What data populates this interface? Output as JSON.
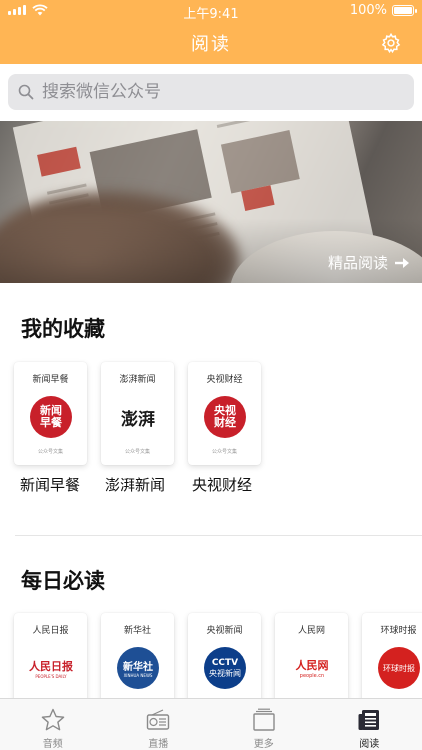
{
  "status_bar": {
    "time": "上午9:41",
    "battery": "100%"
  },
  "nav": {
    "title": "阅读",
    "settings_icon": "gear-icon"
  },
  "search": {
    "placeholder": "搜索微信公众号",
    "icon": "search-icon"
  },
  "banner": {
    "link_label": "精品阅读",
    "icon": "arrow-right-icon"
  },
  "favorites": {
    "title": "我的收藏",
    "items": [
      {
        "card_name": "新闻早餐",
        "logo_text": "新闻早餐",
        "subtitle": "公众号文集",
        "label": "新闻早餐",
        "color": "#c8202a"
      },
      {
        "card_name": "澎湃新闻",
        "logo_text": "澎湃",
        "subtitle": "公众号文集",
        "label": "澎湃新闻",
        "color": "#1a1a1a"
      },
      {
        "card_name": "央视财经",
        "logo_text": "央视财经",
        "subtitle": "公众号文集",
        "label": "央视财经",
        "color": "#c8202a"
      }
    ]
  },
  "daily": {
    "title": "每日必读",
    "items": [
      {
        "card_name": "人民日报",
        "logo_text": "人民日报",
        "logo_sub": "PEOPLE'S DAILY",
        "color": "#c8202a"
      },
      {
        "card_name": "新华社",
        "logo_text": "新华社",
        "logo_sub": "XINHUA NEWS",
        "color": "#1e4f95"
      },
      {
        "card_name": "央视新闻",
        "logo_text": "央视新闻",
        "logo_sub": "CCTV",
        "color": "#0c3e8a"
      },
      {
        "card_name": "人民网",
        "logo_text": "人民网",
        "logo_sub": "people.cn",
        "color": "#d4211f"
      },
      {
        "card_name": "环球时报",
        "logo_text": "环球时报",
        "logo_sub": "",
        "color": "#d4211f"
      }
    ]
  },
  "tabbar": {
    "items": [
      {
        "label": "音频",
        "icon": "star-icon",
        "active": false
      },
      {
        "label": "直播",
        "icon": "radio-icon",
        "active": false
      },
      {
        "label": "更多",
        "icon": "cards-icon",
        "active": false
      },
      {
        "label": "阅读",
        "icon": "newspaper-icon",
        "active": true
      }
    ]
  },
  "colors": {
    "accent": "#FFB554",
    "search_bg": "#e6e6e8"
  }
}
